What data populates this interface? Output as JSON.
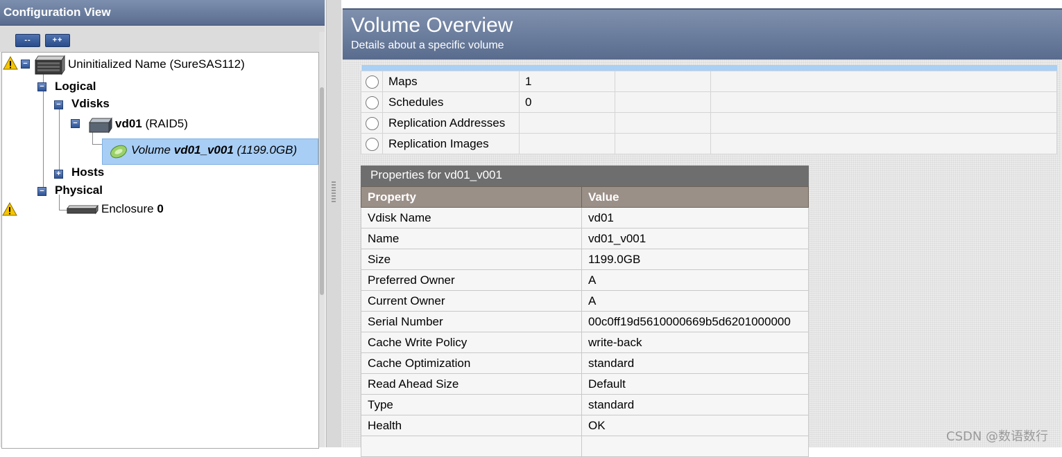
{
  "left_panel": {
    "title": "Configuration View",
    "collapse_all_label": "--",
    "expand_all_label": "++",
    "tree": {
      "system": {
        "label": "Uninitialized Name (SureSAS112)",
        "warning": true
      },
      "logical": "Logical",
      "vdisks": "Vdisks",
      "vdisk": {
        "name": "vd01",
        "raid": "(RAID5)"
      },
      "volume": {
        "prefix": "Volume",
        "name": "vd01_v001",
        "size": "(1199.0GB)"
      },
      "hosts": "Hosts",
      "physical": "Physical",
      "enclosure": {
        "label": "Enclosure",
        "index": "0",
        "warning": true
      }
    }
  },
  "overview": {
    "title": "Volume Overview",
    "subtitle": "Details about a specific volume"
  },
  "components": [
    {
      "name": "Maps",
      "count": "1"
    },
    {
      "name": "Schedules",
      "count": "0"
    },
    {
      "name": "Replication Addresses",
      "count": ""
    },
    {
      "name": "Replication Images",
      "count": ""
    }
  ],
  "properties": {
    "title": "Properties for vd01_v001",
    "headers": {
      "property": "Property",
      "value": "Value"
    },
    "rows": [
      {
        "property": "Vdisk Name",
        "value": "vd01"
      },
      {
        "property": "Name",
        "value": "vd01_v001"
      },
      {
        "property": "Size",
        "value": "1199.0GB"
      },
      {
        "property": "Preferred Owner",
        "value": "A"
      },
      {
        "property": "Current Owner",
        "value": "A"
      },
      {
        "property": "Serial Number",
        "value": "00c0ff19d5610000669b5d6201000000"
      },
      {
        "property": "Cache Write Policy",
        "value": "write-back"
      },
      {
        "property": "Cache Optimization",
        "value": "standard"
      },
      {
        "property": "Read Ahead Size",
        "value": "Default"
      },
      {
        "property": "Type",
        "value": "standard"
      },
      {
        "property": "Health",
        "value": "OK"
      },
      {
        "property": "",
        "value": ""
      }
    ]
  },
  "watermark": "CSDN @数语数行",
  "colors": {
    "header_blue": "#6a7c9e",
    "selection": "#a8cef5",
    "table_header": "#9b9088",
    "props_title": "#6e6e6e",
    "warning": "#f5c400"
  },
  "icons": [
    "warning-icon",
    "server-icon",
    "disk-icon",
    "volume-icon",
    "enclosure-icon",
    "expander-minus-icon",
    "expander-plus-icon"
  ]
}
